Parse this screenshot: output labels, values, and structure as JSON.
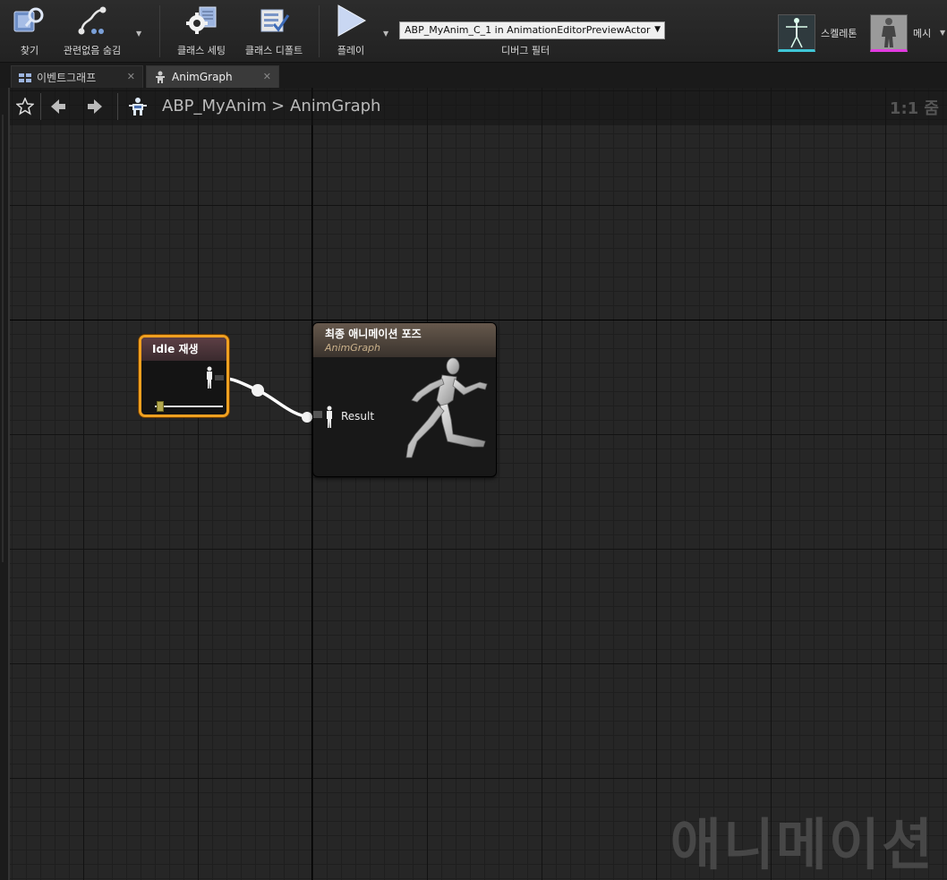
{
  "toolbar": {
    "find": "찾기",
    "hide_unrelated": "관련없음 숨김",
    "class_settings": "클래스 세팅",
    "class_defaults": "클래스 디폴트",
    "play": "플레이",
    "debug_object": "ABP_MyAnim_C_1 in AnimationEditorPreviewActor",
    "debug_filter": "디버그 필터",
    "skeleton": "스켈레톤",
    "mesh": "메시"
  },
  "tabs": [
    {
      "label": "이벤트그래프"
    },
    {
      "label": "AnimGraph"
    }
  ],
  "breadcrumb": {
    "blueprint": "ABP_MyAnim",
    "separator": ">",
    "graph": "AnimGraph",
    "zoom": "1:1 줌"
  },
  "nodes": {
    "idle": {
      "title": "Idle 재생"
    },
    "final_pose": {
      "title": "최종 애니메이션 포즈",
      "subtitle": "AnimGraph",
      "pin": "Result"
    }
  },
  "watermark": "애니메이션",
  "colors": {
    "selection_outline": "#f0a020",
    "wire": "#ffffff",
    "toolbar_bg": "#2a2a2a",
    "graph_bg": "#262626"
  }
}
